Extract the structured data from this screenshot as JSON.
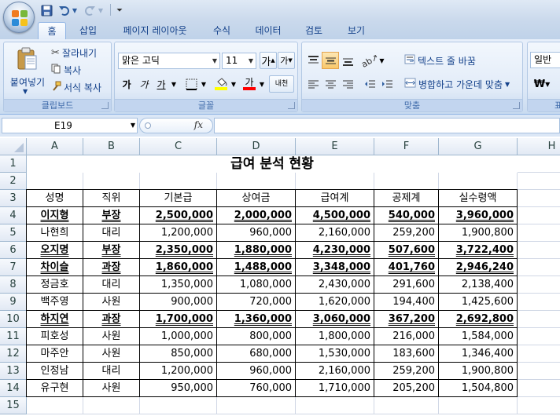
{
  "qat": {
    "icons": [
      "save-icon",
      "undo-icon",
      "redo-icon",
      "customize-qat-icon"
    ],
    "customize_glyph": "⏷"
  },
  "tabs": [
    {
      "label": "홈",
      "active": true
    },
    {
      "label": "삽입"
    },
    {
      "label": "페이지 레이아웃"
    },
    {
      "label": "수식"
    },
    {
      "label": "데이터"
    },
    {
      "label": "검토"
    },
    {
      "label": "보기"
    }
  ],
  "ribbon": {
    "clipboard": {
      "label": "클립보드",
      "paste": "붙여넣기",
      "cut": "잘라내기",
      "copy": "복사",
      "format_painter": "서식 복사"
    },
    "font": {
      "label": "글꼴",
      "font_name": "맑은 고딕",
      "font_size": "11",
      "grow": "가",
      "shrink": "가",
      "bold": "가",
      "italic": "가",
      "underline": "가",
      "font_color_glyph": "가",
      "phonetic": "내천"
    },
    "alignment": {
      "label": "맞춤",
      "wrap_text": "텍스트 줄 바꿈",
      "merge_center": "병합하고 가운데 맞춤"
    },
    "number": {
      "format": "일반",
      "currency": "₩",
      "label_partial": "표"
    },
    "colors": {
      "fill": "#ffff00",
      "font": "#ff0000",
      "accent": "#15428b"
    }
  },
  "formula_bar": {
    "name_box": "E19",
    "fx": "fx",
    "formula": ""
  },
  "sheet": {
    "columns": [
      "A",
      "B",
      "C",
      "D",
      "E",
      "F",
      "G",
      "H"
    ],
    "rows": [
      "1",
      "2",
      "3",
      "4",
      "5",
      "6",
      "7",
      "8",
      "9",
      "10",
      "11",
      "12",
      "13",
      "14",
      "15"
    ],
    "title": "급여 분석 현황",
    "headers": [
      "성명",
      "직위",
      "기본급",
      "상여금",
      "급여계",
      "공제계",
      "실수령액"
    ],
    "records": [
      {
        "cells": [
          "이지형",
          "부장",
          "2,500,000",
          "2,000,000",
          "4,500,000",
          "540,000",
          "3,960,000"
        ],
        "highlight": true
      },
      {
        "cells": [
          "나현희",
          "대리",
          "1,200,000",
          "960,000",
          "2,160,000",
          "259,200",
          "1,900,800"
        ],
        "highlight": false
      },
      {
        "cells": [
          "오지명",
          "부장",
          "2,350,000",
          "1,880,000",
          "4,230,000",
          "507,600",
          "3,722,400"
        ],
        "highlight": true
      },
      {
        "cells": [
          "차이슬",
          "과장",
          "1,860,000",
          "1,488,000",
          "3,348,000",
          "401,760",
          "2,946,240"
        ],
        "highlight": true
      },
      {
        "cells": [
          "정금호",
          "대리",
          "1,350,000",
          "1,080,000",
          "2,430,000",
          "291,600",
          "2,138,400"
        ],
        "highlight": false
      },
      {
        "cells": [
          "백주영",
          "사원",
          "900,000",
          "720,000",
          "1,620,000",
          "194,400",
          "1,425,600"
        ],
        "highlight": false
      },
      {
        "cells": [
          "하지연",
          "과장",
          "1,700,000",
          "1,360,000",
          "3,060,000",
          "367,200",
          "2,692,800"
        ],
        "highlight": true
      },
      {
        "cells": [
          "피호성",
          "사원",
          "1,000,000",
          "800,000",
          "1,800,000",
          "216,000",
          "1,584,000"
        ],
        "highlight": false
      },
      {
        "cells": [
          "마주안",
          "사원",
          "850,000",
          "680,000",
          "1,530,000",
          "183,600",
          "1,346,400"
        ],
        "highlight": false
      },
      {
        "cells": [
          "인정남",
          "대리",
          "1,200,000",
          "960,000",
          "2,160,000",
          "259,200",
          "1,900,800"
        ],
        "highlight": false
      },
      {
        "cells": [
          "유구현",
          "사원",
          "950,000",
          "760,000",
          "1,710,000",
          "205,200",
          "1,504,800"
        ],
        "highlight": false
      }
    ]
  }
}
